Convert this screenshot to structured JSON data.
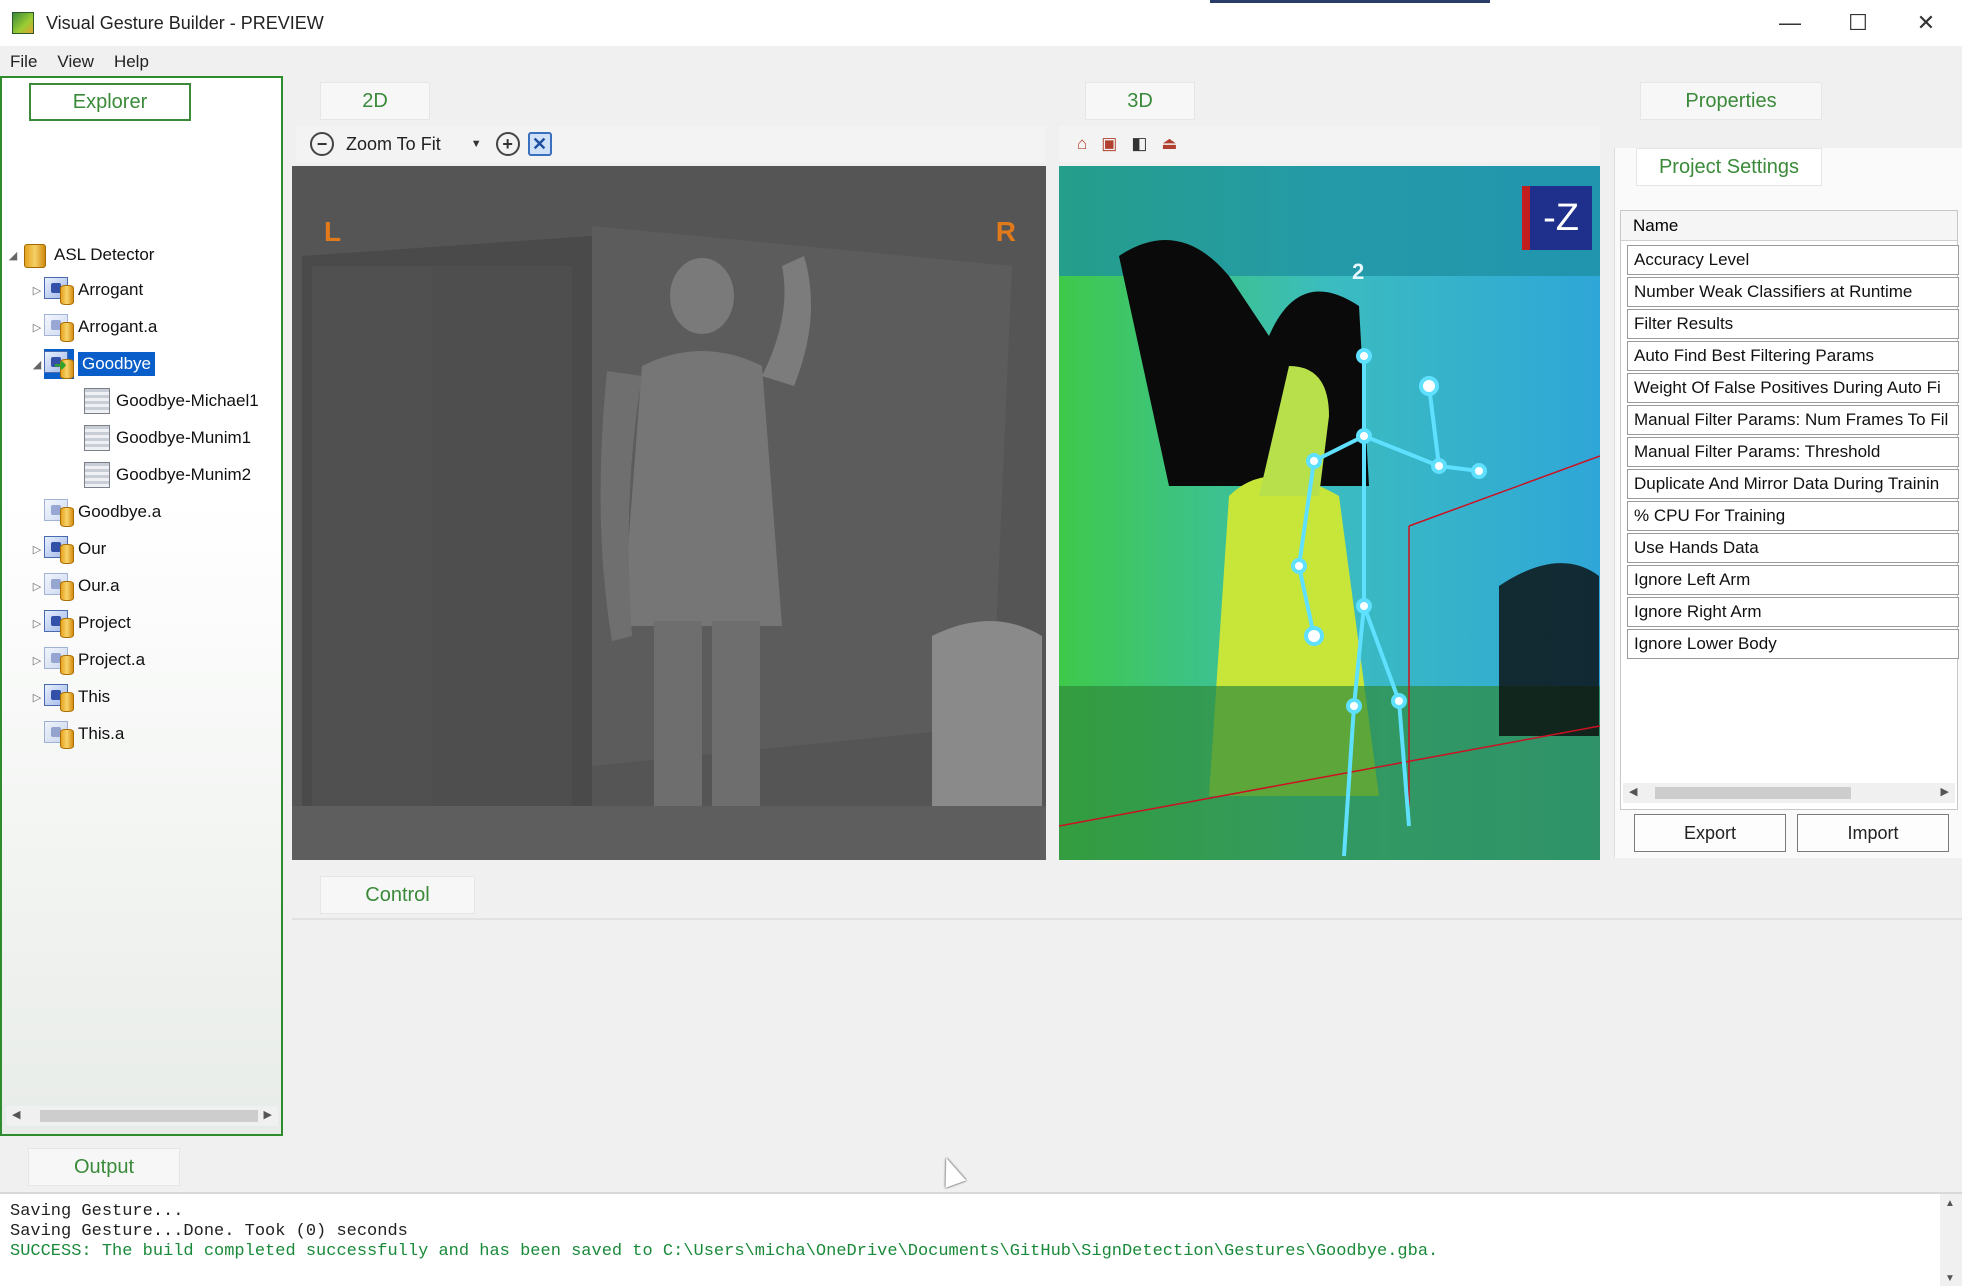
{
  "window": {
    "title": "Visual Gesture Builder - PREVIEW",
    "controls": {
      "minimize": "—",
      "maximize": "☐",
      "close": "✕"
    }
  },
  "menu": [
    "File",
    "View",
    "Help"
  ],
  "explorer": {
    "tab_label": "Explorer",
    "root": "ASL Detector",
    "items": [
      {
        "label": "Arrogant",
        "icon": "gesture-project-icon"
      },
      {
        "label": "Arrogant.a",
        "icon": "database-icon"
      },
      {
        "label": "Goodbye",
        "icon": "gesture-project-icon",
        "selected": true,
        "expanded": true
      },
      {
        "label": "Goodbye-Michael1",
        "icon": "clip-icon"
      },
      {
        "label": "Goodbye-Munim1",
        "icon": "clip-icon"
      },
      {
        "label": "Goodbye-Munim2",
        "icon": "clip-icon"
      },
      {
        "label": "Goodbye.a",
        "icon": "database-icon"
      },
      {
        "label": "Our",
        "icon": "gesture-project-icon"
      },
      {
        "label": "Our.a",
        "icon": "database-icon"
      },
      {
        "label": "Project",
        "icon": "gesture-project-icon"
      },
      {
        "label": "Project.a",
        "icon": "database-icon"
      },
      {
        "label": "This",
        "icon": "gesture-project-icon"
      },
      {
        "label": "This.a",
        "icon": "database-icon"
      }
    ]
  },
  "view2d": {
    "tab_label": "2D",
    "zoom_label": "Zoom To Fit",
    "left_marker": "L",
    "right_marker": "R"
  },
  "view3d": {
    "tab_label": "3D",
    "axis_label": "-Z",
    "body_index": "2"
  },
  "control": {
    "tab_label": "Control"
  },
  "properties": {
    "tab_label": "Properties",
    "section_label": "Project Settings",
    "column_header": "Name",
    "rows": [
      "Accuracy Level",
      "Number Weak Classifiers at Runtime",
      "Filter Results",
      "Auto Find Best Filtering Params",
      "Weight Of False Positives During Auto Fi",
      "Manual Filter Params: Num Frames To Fil",
      "Manual Filter Params: Threshold",
      "Duplicate And Mirror Data During Trainin",
      "% CPU For Training",
      "Use Hands Data",
      "Ignore Left Arm",
      "Ignore Right Arm",
      "Ignore Lower Body"
    ],
    "export_label": "Export",
    "import_label": "Import"
  },
  "output": {
    "tab_label": "Output",
    "lines": [
      "Saving Gesture...",
      "Saving Gesture...Done. Took (0) seconds",
      "SUCCESS: The build completed successfully and has been saved to C:\\Users\\micha\\OneDrive\\Documents\\GitHub\\SignDetection\\Gestures\\Goodbye.gba."
    ]
  }
}
